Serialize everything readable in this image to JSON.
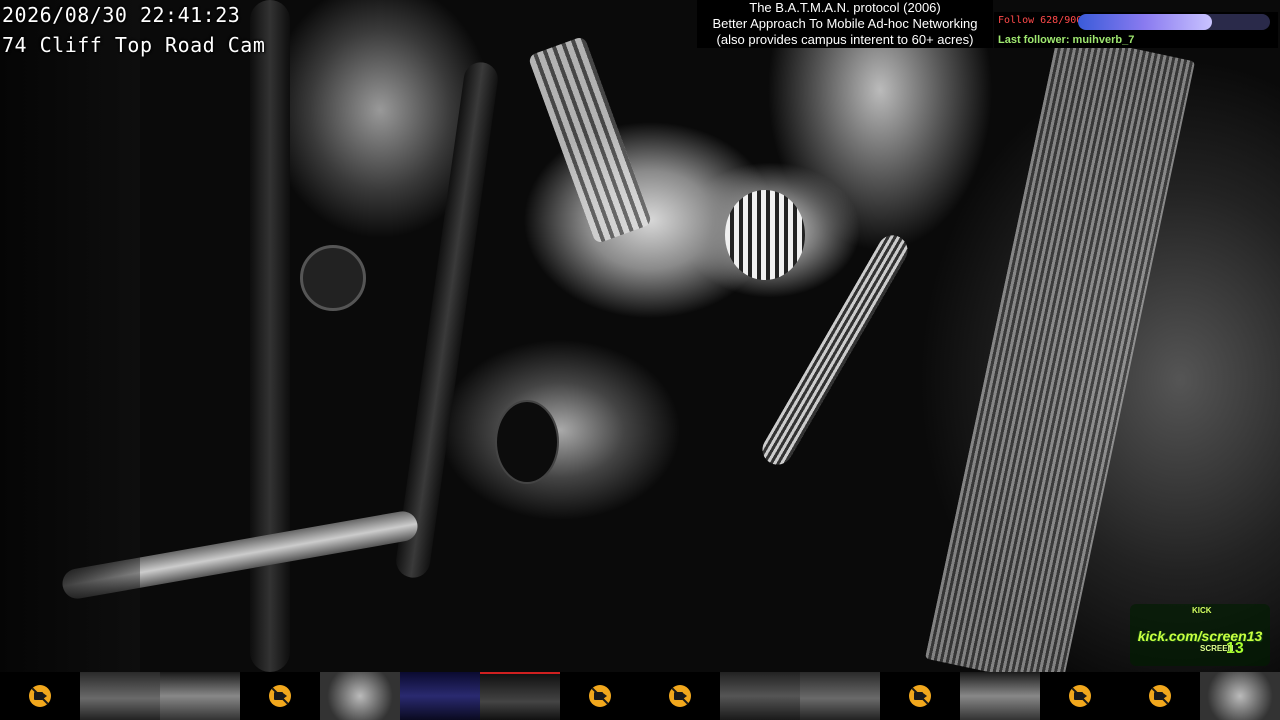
{
  "overlay": {
    "timestamp": "2026/08/30 22:41:23",
    "camera_name": "74 Cliff Top Road Cam"
  },
  "info_box": {
    "line1": "The B.A.T.M.A.N. protocol (2006)",
    "line2": "Better Approach To Mobile Ad-hoc Networking",
    "line3": "(also provides campus interent to 60+ acres)"
  },
  "follow_goal": {
    "label": "Follow 628/900",
    "current": 628,
    "goal": 900,
    "last_follower": "Last follower: muihverb_7"
  },
  "logo": {
    "text": "kick.com/screen13",
    "small": "KICK",
    "sub": "SCREEN",
    "big": "13"
  },
  "camera_strip": [
    {
      "name": "cam-1",
      "status": "off",
      "icon": "camera-off-icon"
    },
    {
      "name": "cam-2",
      "status": "live"
    },
    {
      "name": "cam-3",
      "status": "live"
    },
    {
      "name": "cam-4",
      "status": "off",
      "icon": "camera-off-icon"
    },
    {
      "name": "cam-5",
      "status": "live"
    },
    {
      "name": "cam-6",
      "status": "live"
    },
    {
      "name": "cam-7",
      "status": "live",
      "active": true
    },
    {
      "name": "cam-8",
      "status": "off",
      "icon": "camera-off-icon"
    },
    {
      "name": "cam-9",
      "status": "off",
      "icon": "camera-off-icon"
    },
    {
      "name": "cam-10",
      "status": "live"
    },
    {
      "name": "cam-11",
      "status": "live"
    },
    {
      "name": "cam-12",
      "status": "off",
      "icon": "camera-off-icon"
    },
    {
      "name": "cam-13",
      "status": "live"
    },
    {
      "name": "cam-14",
      "status": "off",
      "icon": "camera-off-icon"
    },
    {
      "name": "cam-15",
      "status": "off",
      "icon": "camera-off-icon"
    },
    {
      "name": "cam-16",
      "status": "live"
    }
  ],
  "colors": {
    "follow_label": "#ff4a4a",
    "last_follower": "#9fe870",
    "active_cam_border": "#d02020",
    "camera_off_badge": "#f2a81d"
  }
}
